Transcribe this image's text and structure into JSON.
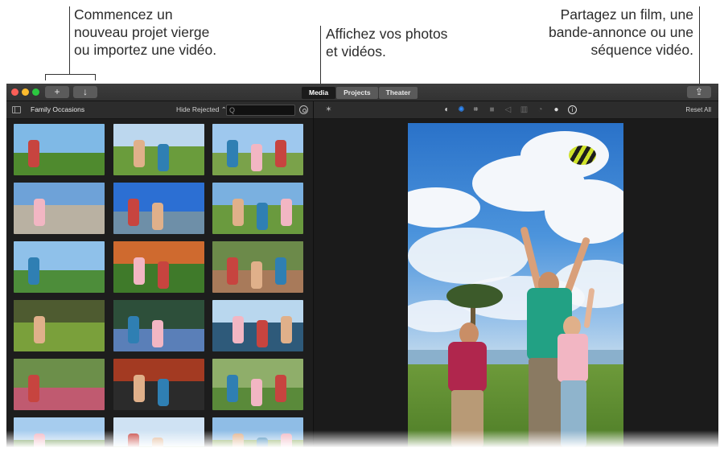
{
  "callouts": {
    "left": [
      "Commencez un",
      "nouveau projet vierge",
      "ou importez une vidéo."
    ],
    "middle": [
      "Affichez vos photos",
      "et vidéos."
    ],
    "right": [
      "Partagez un film, une",
      "bande-annonce ou une",
      "séquence vidéo."
    ]
  },
  "toolbar": {
    "new_icon": "+",
    "import_icon": "↓",
    "share_icon": "⇪",
    "tabs": [
      {
        "label": "Media",
        "active": true
      },
      {
        "label": "Projects",
        "active": false
      },
      {
        "label": "Theater",
        "active": false
      }
    ]
  },
  "browser": {
    "library_title": "Family Occasions",
    "filter_label": "Hide Rejected ⌃",
    "search_placeholder": "Q"
  },
  "viewer": {
    "reset_label": "Reset All",
    "tool_icons": [
      "magic-wand-icon",
      "color-balance-icon",
      "color-correction-icon",
      "crop-icon",
      "stabilization-icon",
      "volume-icon",
      "noise-reduction-icon",
      "speed-icon",
      "filter-icon",
      "info-icon"
    ]
  },
  "colors": {
    "window_bg": "#1f1f1f",
    "titlebar": "#3a3a3a",
    "accent_blue": "#2f8cff",
    "close": "#fc5f57",
    "minimize": "#fdbb2e",
    "maximize": "#2bc840"
  },
  "thumbnails": [
    {
      "sky": "#7fb9e6",
      "ground": "#4f8a2e"
    },
    {
      "sky": "#bcd7ee",
      "ground": "#6a9c3c"
    },
    {
      "sky": "#9ec8ee",
      "ground": "#7aa24a"
    },
    {
      "sky": "#6ea2d8",
      "ground": "#b9b1a2"
    },
    {
      "sky": "#2c6fd3",
      "ground": "#6e8fa8"
    },
    {
      "sky": "#7ab0e0",
      "ground": "#6a9a3e"
    },
    {
      "sky": "#8fc1ea",
      "ground": "#4d8d3a"
    },
    {
      "sky": "#cf6a2f",
      "ground": "#3f7a2a"
    },
    {
      "sky": "#6c8a4a",
      "ground": "#a87a5a"
    },
    {
      "sky": "#4e5b30",
      "ground": "#7aa03b"
    },
    {
      "sky": "#2d4f3a",
      "ground": "#5a7fb8"
    },
    {
      "sky": "#b9d7ee",
      "ground": "#2e5a7a"
    },
    {
      "sky": "#6c8f4a",
      "ground": "#c05a70"
    },
    {
      "sky": "#a33a22",
      "ground": "#2b2b2b"
    },
    {
      "sky": "#8fae6a",
      "ground": "#5a8a3a"
    },
    {
      "sky": "#a6ccee",
      "ground": "#5a8a3a"
    },
    {
      "sky": "#cfe2f3",
      "ground": "#4b8d34"
    },
    {
      "sky": "#8fbde6",
      "ground": "#7ea24a"
    }
  ]
}
